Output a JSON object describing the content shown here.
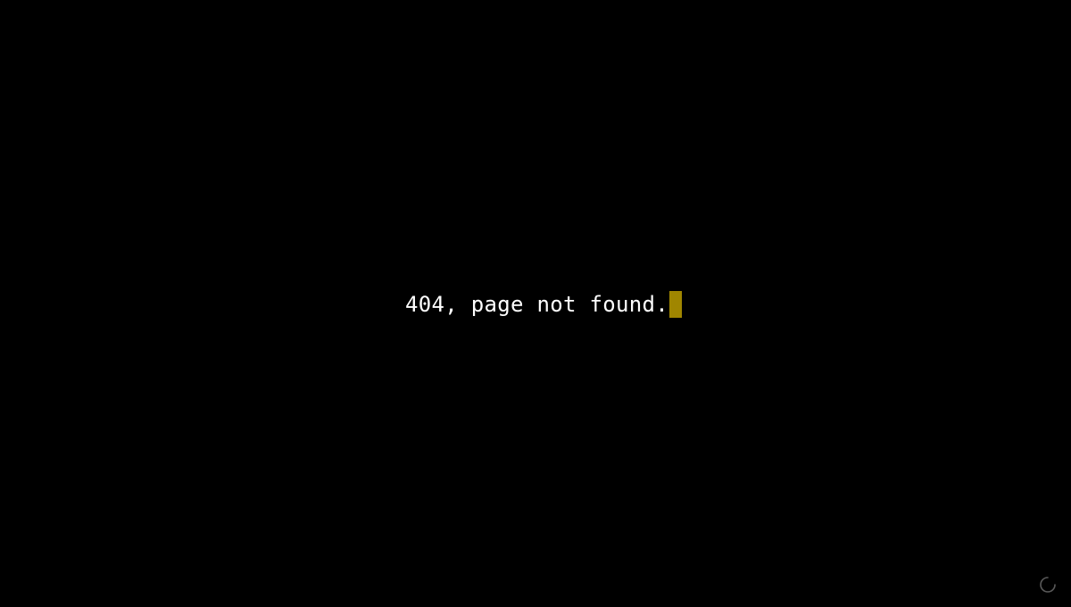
{
  "message": {
    "text": "404, page not found."
  },
  "cursor": {
    "color": "#a08600"
  },
  "colors": {
    "background": "#000000",
    "text": "#ffffff",
    "spinner": "#5a5a5a"
  },
  "icons": {
    "loading": "loading-spinner-icon"
  }
}
